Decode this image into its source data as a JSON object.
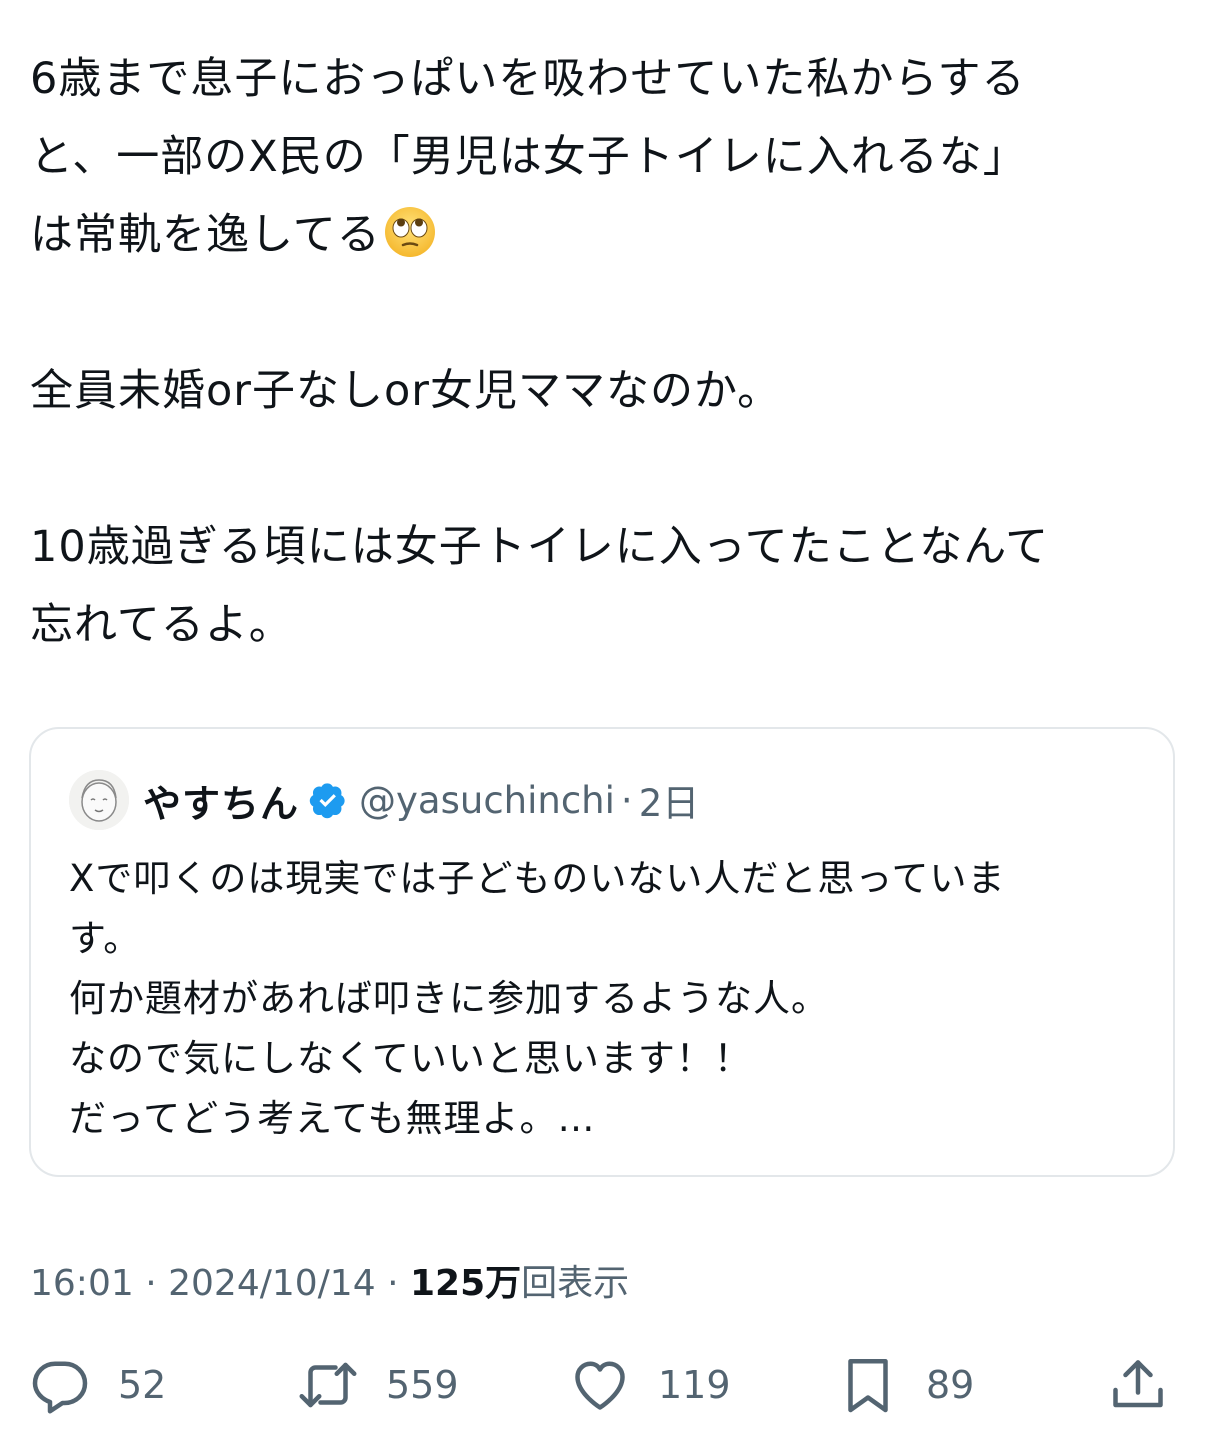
{
  "tweet": {
    "lines_1": [
      "6歳まで息子におっぱいを吸わせていた私からする",
      "と、一部のX民の「男児は女子トイレに入れるな」",
      "は常軌を逸してる"
    ],
    "emoji_1": "face-with-rolling-eyes",
    "line_2": "全員未婚or子なしor女児ママなのか。",
    "lines_3": [
      "10歳過ぎる頃には女子トイレに入ってたことなんて",
      "忘れてるよ。"
    ]
  },
  "quote": {
    "name": "やすちん",
    "handle": "@yasuchinchi",
    "separator": "·",
    "time": "2日",
    "lines": [
      "Xで叩くのは現実では子どものいない人だと思っていま",
      "す。",
      "何か題材があれば叩きに参加するような人。",
      "なので気にしなくていいと思います！！",
      "だってどう考えても無理よ。…"
    ]
  },
  "meta": {
    "time": "16:01",
    "separator": "·",
    "date": "2024/10/14",
    "views_count": "125万",
    "views_label": "回表示"
  },
  "actions": {
    "replies": "52",
    "reposts": "559",
    "likes": "119",
    "bookmarks": "89"
  },
  "colors": {
    "text": "#0f1419",
    "secondary": "#536471",
    "verified": "#1d9bf0",
    "border": "#e3e7ea"
  },
  "icons": [
    "verified-badge-icon",
    "reply-icon",
    "repost-icon",
    "like-icon",
    "bookmark-icon",
    "share-icon"
  ]
}
